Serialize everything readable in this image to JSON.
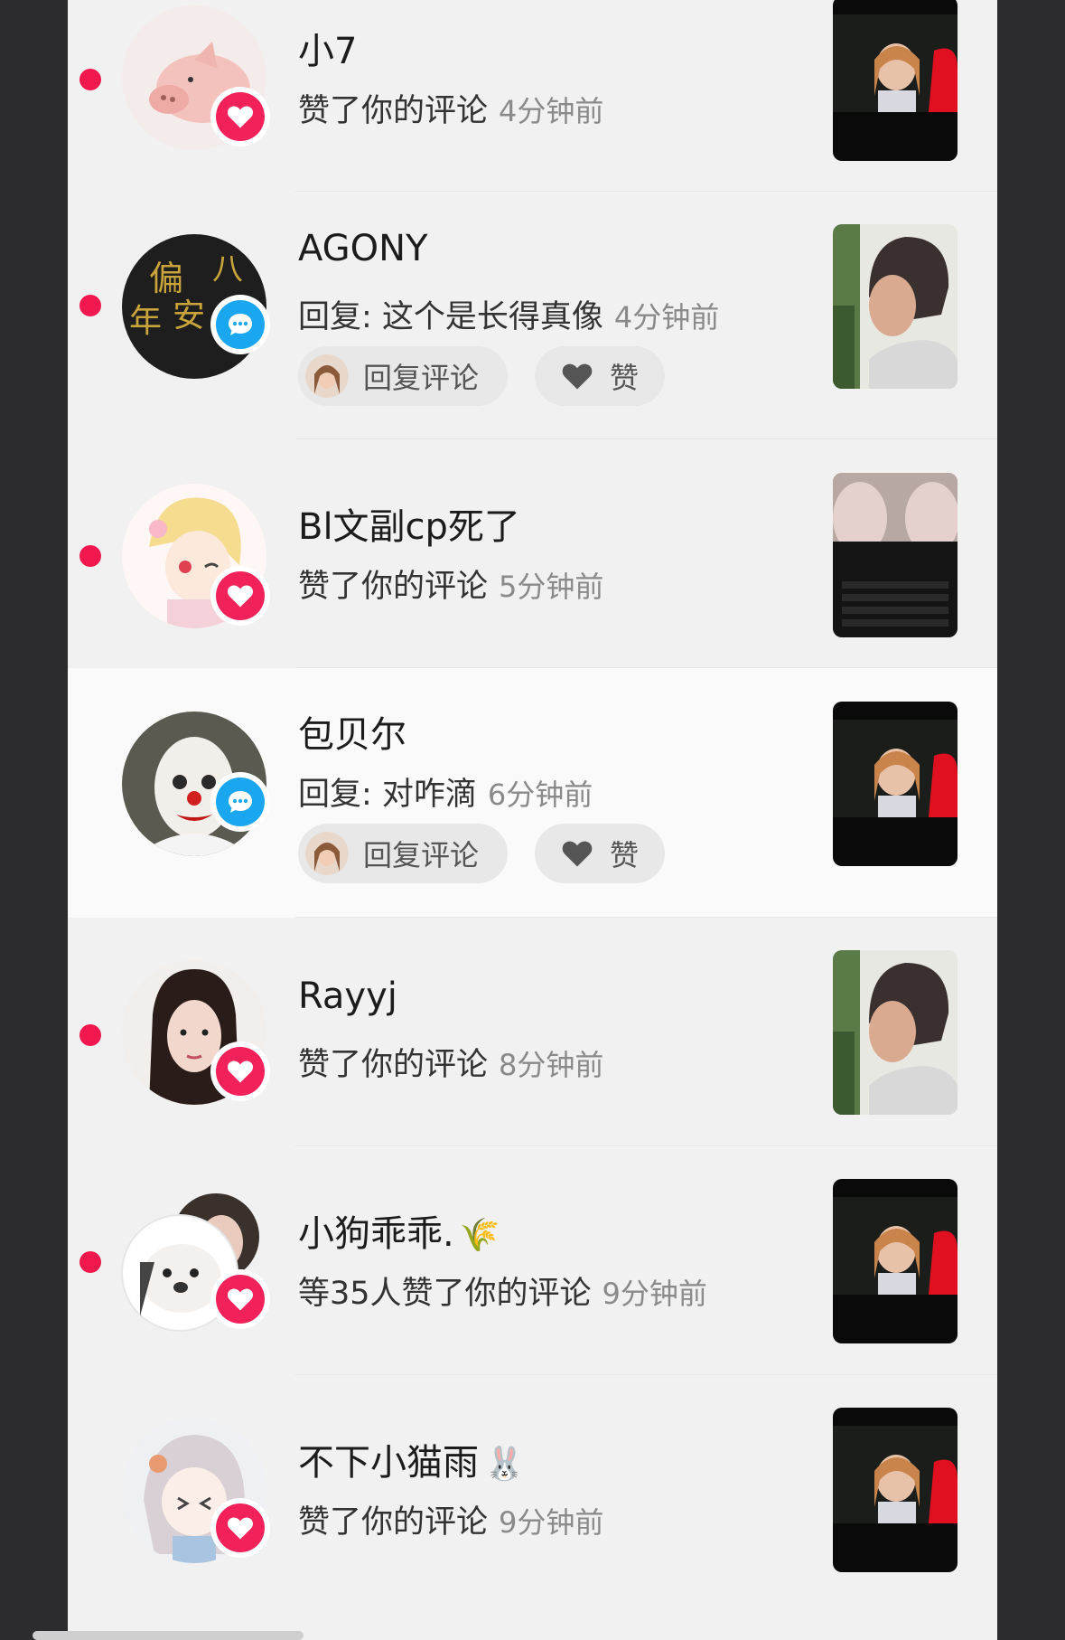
{
  "notifications": [
    {
      "name": "小7",
      "action": "赞了你的评论",
      "time": "4分钟前",
      "type": "like",
      "unread": true,
      "avatar": "pig",
      "thumb": "idol"
    },
    {
      "name": "AGONY",
      "action": "回复: 这个是长得真像",
      "time": "4分钟前",
      "type": "comment",
      "unread": true,
      "avatar": "calligraphy",
      "thumb": "woman",
      "reply_label": "回复评论",
      "like_label": "赞"
    },
    {
      "name": "Bl文副cp死了",
      "action": "赞了你的评论",
      "time": "5分钟前",
      "type": "like",
      "unread": true,
      "avatar": "anime-blonde",
      "thumb": "laptop"
    },
    {
      "name": "包贝尔",
      "action": "回复: 对咋滴",
      "time": "6分钟前",
      "type": "comment",
      "unread": false,
      "avatar": "clown",
      "thumb": "idol",
      "reply_label": "回复评论",
      "like_label": "赞"
    },
    {
      "name": "Rayyj",
      "action": "赞了你的评论",
      "time": "8分钟前",
      "type": "like",
      "unread": true,
      "avatar": "girl",
      "thumb": "woman"
    },
    {
      "name": "小狗乖乖.",
      "name_emoji": "🌾",
      "action": "等35人赞了你的评论",
      "time": "9分钟前",
      "type": "like",
      "unread": true,
      "avatar": "dog-stack",
      "thumb": "idol"
    },
    {
      "name": "不下小猫雨",
      "name_emoji": "🐰",
      "action": "赞了你的评论",
      "time": "9分钟前",
      "type": "like",
      "unread": false,
      "avatar": "anime-grey",
      "thumb": "idol"
    }
  ],
  "colors": {
    "unread_dot": "#f0184f",
    "like_badge": "#f2215a",
    "comment_badge": "#1aa7f0",
    "time_text": "#8a8a8a"
  },
  "icons": {
    "like_badge": "heart-icon",
    "comment_badge": "chat-bubble-icon",
    "like_pill": "heart-icon"
  }
}
